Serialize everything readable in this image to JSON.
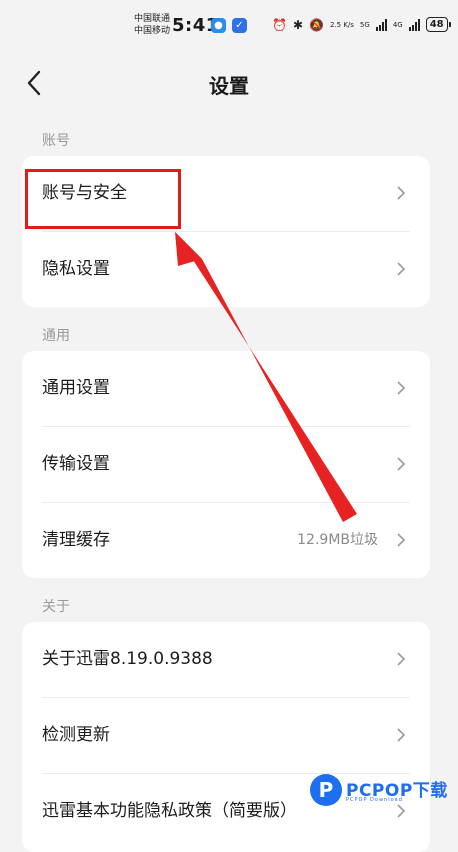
{
  "status_bar": {
    "carrier1": "中国联通",
    "carrier2": "中国移动",
    "time": "5:41",
    "net_speed": "2.5 K/s",
    "net1": "5G",
    "net2": "4G",
    "battery": "48"
  },
  "header": {
    "title": "设置"
  },
  "sections": {
    "account": {
      "label": "账号",
      "items": [
        {
          "label": "账号与安全"
        },
        {
          "label": "隐私设置"
        }
      ]
    },
    "general": {
      "label": "通用",
      "items": [
        {
          "label": "通用设置"
        },
        {
          "label": "传输设置"
        },
        {
          "label": "清理缓存",
          "value": "12.9MB垃圾"
        }
      ]
    },
    "about": {
      "label": "关于",
      "items": [
        {
          "label": "关于迅雷8.19.0.9388"
        },
        {
          "label": "检测更新"
        },
        {
          "label": "迅雷基本功能隐私政策（简要版）"
        }
      ]
    }
  },
  "watermark": {
    "brand": "PCPOP下载",
    "sub": "PCPOP Download"
  },
  "colors": {
    "annotation": "#e01b1b",
    "brand": "#1e6ef0"
  }
}
